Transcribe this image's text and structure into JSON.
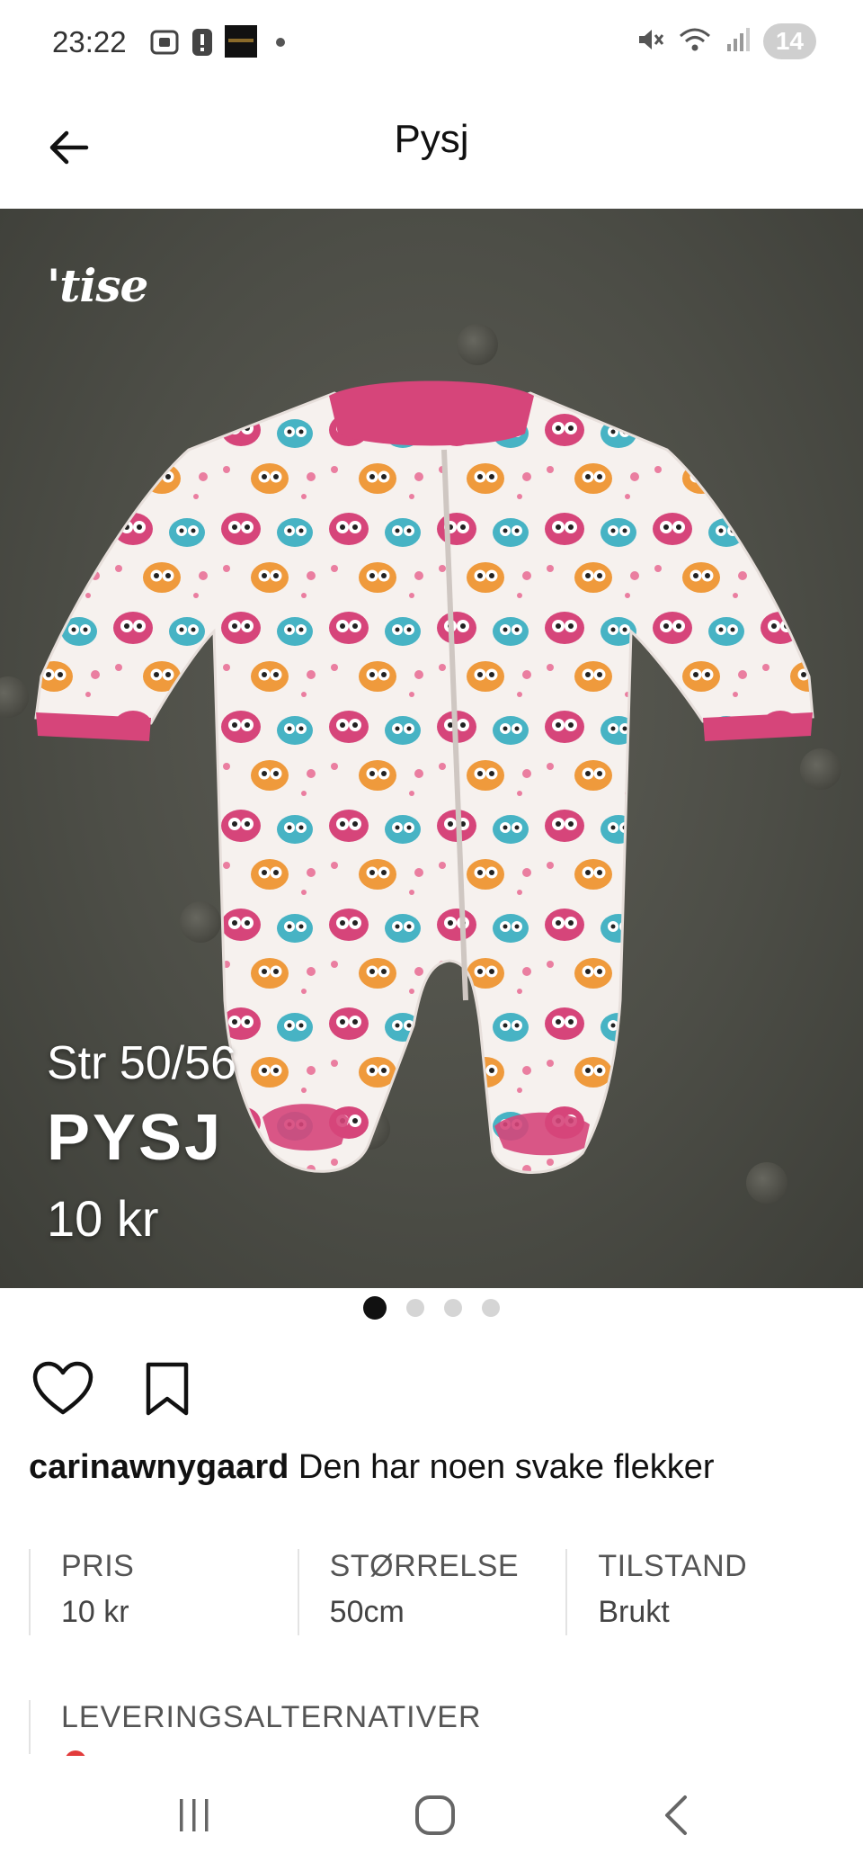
{
  "status_bar": {
    "time": "23:22",
    "icons": [
      "screenshot-icon",
      "alert-icon",
      "app-icon",
      "dot-icon",
      "mute-icon",
      "wifi-icon",
      "signal-icon"
    ],
    "badge": "14"
  },
  "header": {
    "title": "Pysj",
    "back_icon": "arrow-left-icon"
  },
  "photo": {
    "logo_text": "'tise",
    "size_text": "Str 50/56",
    "title_text": "PYSJ",
    "price_text": "10 kr",
    "carousel_total": 4,
    "carousel_active": 0
  },
  "actions": {
    "like_icon": "heart-icon",
    "save_icon": "bookmark-icon"
  },
  "caption": {
    "username": "carinawnygaard",
    "text": "Den har noen svake flekker"
  },
  "details": [
    {
      "label": "PRIS",
      "value": "10 kr"
    },
    {
      "label": "STØRRELSE",
      "value": "50cm"
    },
    {
      "label": "TILSTAND",
      "value": "Brukt"
    }
  ],
  "delivery": {
    "label": "LEVERINGSALTERNATIVER"
  },
  "colors": {
    "accent_pink": "#d6457a",
    "photo_bg": "#4d4e47",
    "delivery_red": "#e23b3b"
  },
  "nav_bar": {
    "icons": [
      "recent-apps-icon",
      "home-icon",
      "back-icon"
    ]
  }
}
